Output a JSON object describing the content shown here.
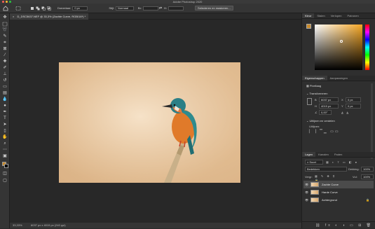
{
  "app": {
    "title": "Adobe Photoshop 2020"
  },
  "options_bar": {
    "feather_label": "Doezelaar:",
    "feather_value": "0 px",
    "style_label": "Stijl:",
    "style_value": "Normaal",
    "width_label": "Br:",
    "height_label": "H:",
    "select_mask_button": "Selecteren en maskeren..."
  },
  "document": {
    "tab_label": "D_DSC5637.NEF @ 33,3% (Zachte Curve, RGB/16*) *"
  },
  "status": {
    "zoom": "33,33%",
    "dims": "6037 px x 4019 px (240 ppi)"
  },
  "panels": {
    "color_tabs": [
      "Kleur",
      "Stalen",
      "Verlopen",
      "Patronen"
    ],
    "properties_tabs": [
      "Eigenschappen",
      "Aanpassingen"
    ],
    "properties": {
      "doc_label": "Pixellaag",
      "transform_header": "Transformeren",
      "w_label": "B",
      "w_value": "6037 px",
      "x_label": "X",
      "x_value": "0 px",
      "h_label": "H",
      "h_value": "4019 px",
      "y_label": "Y",
      "y_value": "0 px",
      "angle_value": "0,00°",
      "align_header": "Uitlijnen en verdelen",
      "align_label": "Uitlijnen:"
    },
    "layers_tabs": [
      "Lagen",
      "Kanalen",
      "Paden"
    ],
    "layers": {
      "filter_value": "Soort",
      "blend_mode": "Bedekken",
      "opacity_label": "Dekking:",
      "opacity_value": "100%",
      "fill_label": "Vul:",
      "fill_value": "100%",
      "lock_label": "Vergr:",
      "items": [
        {
          "name": "Zachte Curve"
        },
        {
          "name": "Harde Curve"
        },
        {
          "name": "Achtergrond"
        }
      ]
    }
  },
  "colors": {
    "hue_color": "#f5a623",
    "fg_color": "#c88a2c"
  }
}
